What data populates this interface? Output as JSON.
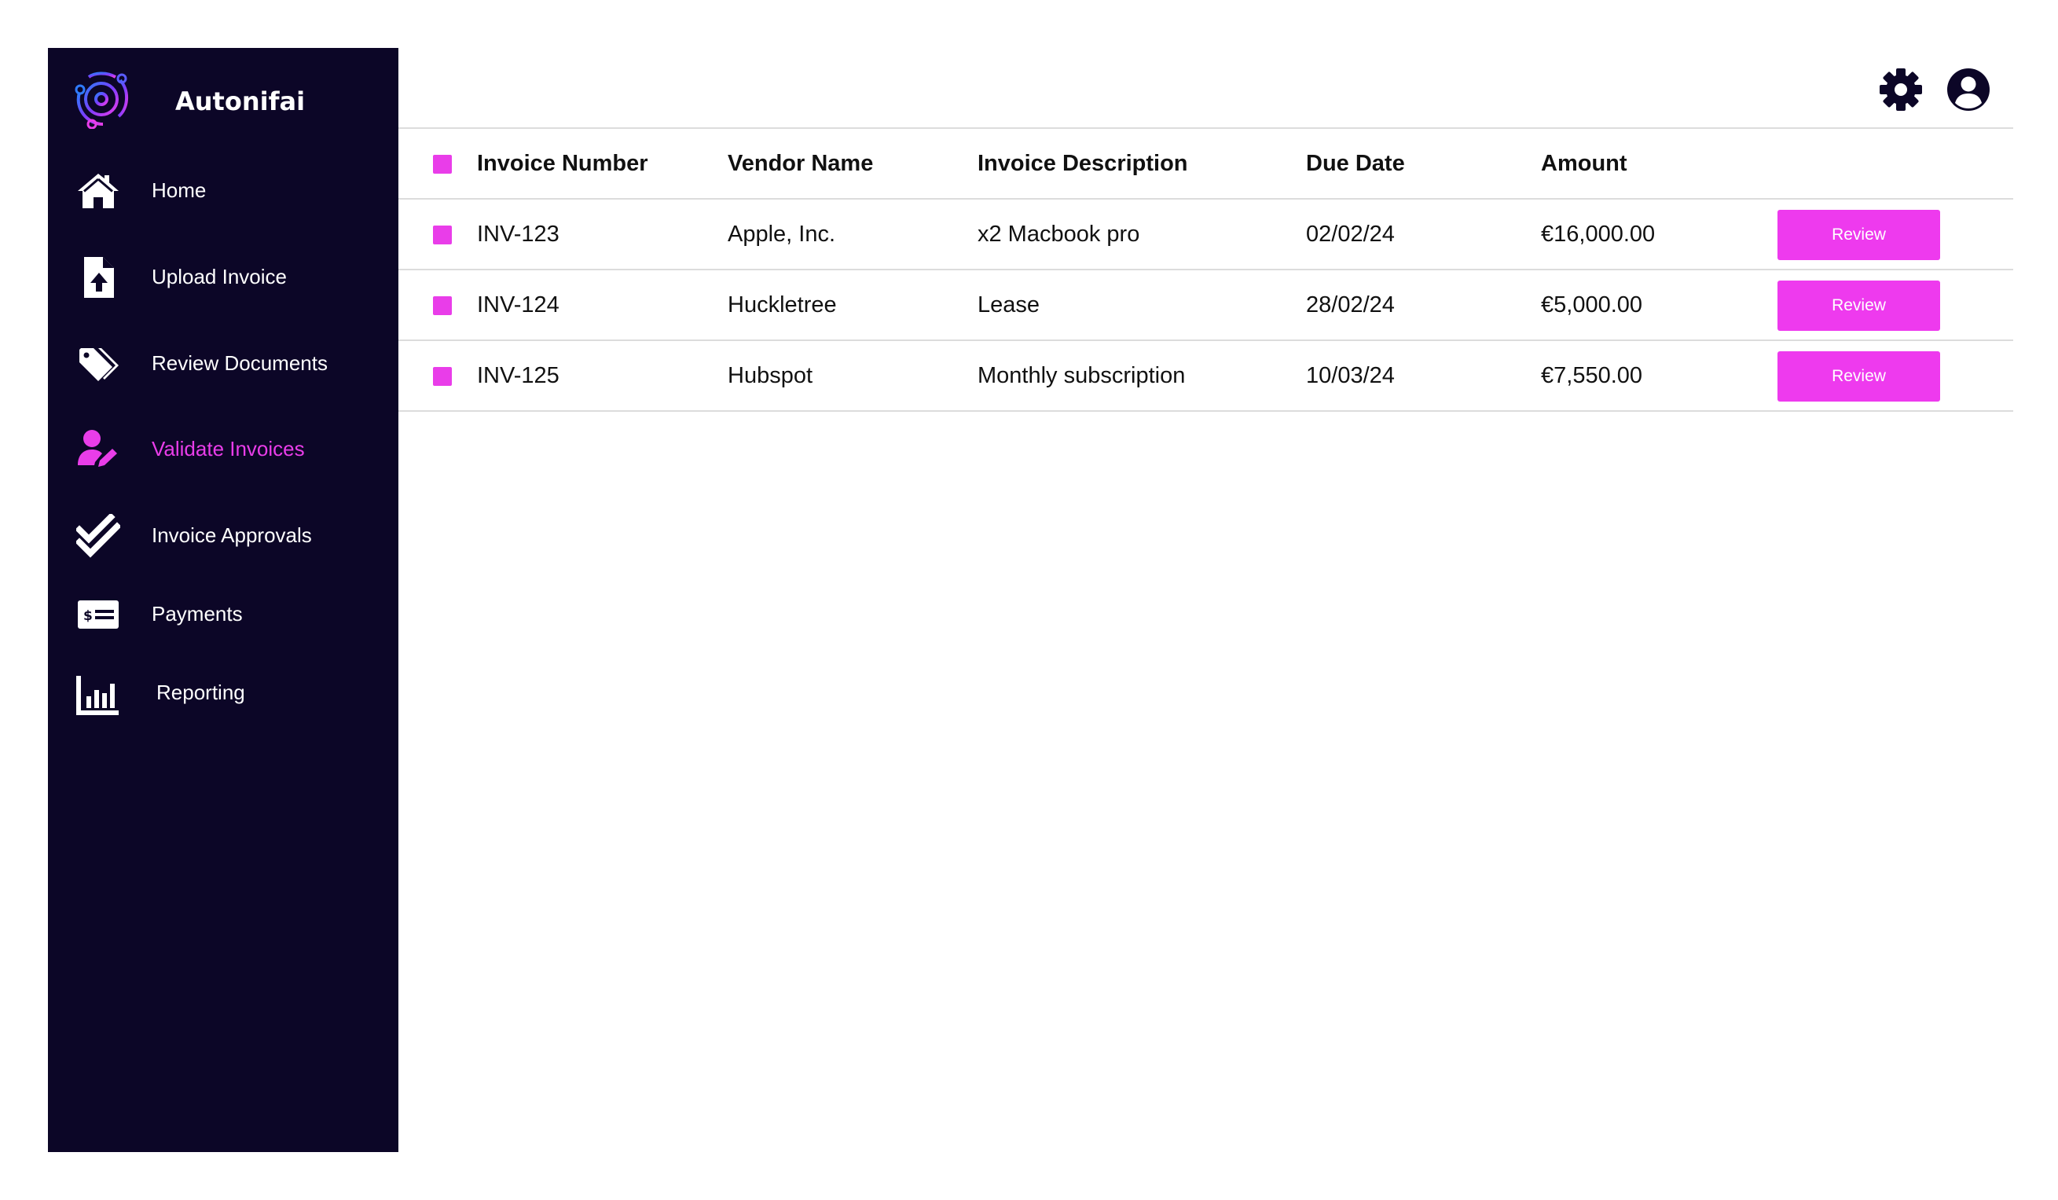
{
  "brand": {
    "name": "Autonifai"
  },
  "colors": {
    "sidebar_bg": "#0c0627",
    "accent": "#e93de9",
    "text": "#111111",
    "divider": "#dcdcdc"
  },
  "sidebar": {
    "items": [
      {
        "label": "Home",
        "icon": "home-icon",
        "active": false
      },
      {
        "label": "Upload Invoice",
        "icon": "file-upload-icon",
        "active": false
      },
      {
        "label": "Review Documents",
        "icon": "tags-icon",
        "active": false
      },
      {
        "label": "Validate Invoices",
        "icon": "user-edit-icon",
        "active": true
      },
      {
        "label": "Invoice Approvals",
        "icon": "double-check-icon",
        "active": false
      },
      {
        "label": "Payments",
        "icon": "money-check-icon",
        "active": false
      },
      {
        "label": "Reporting",
        "icon": "bar-chart-icon",
        "active": false
      }
    ]
  },
  "header": {
    "settings_icon": "gear-icon",
    "account_icon": "user-circle-icon"
  },
  "table": {
    "columns": [
      "Invoice Number",
      "Vendor Name",
      "Invoice Description",
      "Due Date",
      "Amount"
    ],
    "rows": [
      {
        "number": "INV-123",
        "vendor": "Apple, Inc.",
        "description": "x2 Macbook pro",
        "due": "02/02/24",
        "amount": "€16,000.00",
        "action": "Review"
      },
      {
        "number": "INV-124",
        "vendor": "Huckletree",
        "description": "Lease",
        "due": "28/02/24",
        "amount": "€5,000.00",
        "action": "Review"
      },
      {
        "number": "INV-125",
        "vendor": "Hubspot",
        "description": "Monthly subscription",
        "due": "10/03/24",
        "amount": "€7,550.00",
        "action": "Review"
      }
    ]
  }
}
